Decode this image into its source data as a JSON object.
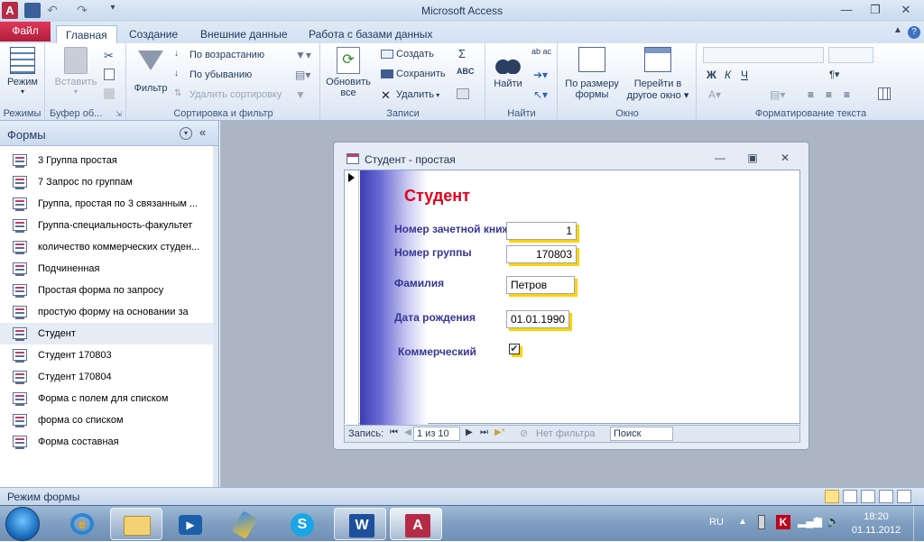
{
  "window": {
    "title": "Microsoft Access"
  },
  "tabs": [
    {
      "label": "Файл"
    },
    {
      "label": "Главная"
    },
    {
      "label": "Создание"
    },
    {
      "label": "Внешние данные"
    },
    {
      "label": "Работа с базами данных"
    }
  ],
  "ribbon": {
    "groups": {
      "views": "Режимы",
      "clipboard": "Буфер об...",
      "sort": "Сортировка и фильтр",
      "records": "Записи",
      "find": "Найти",
      "window": "Окно",
      "text": "Форматирование текста"
    },
    "views": {
      "mode": "Режим"
    },
    "clipboard": {
      "paste": "Вставить"
    },
    "sort": {
      "filter": "Фильтр",
      "ascending": "По возрастанию",
      "descending": "По убыванию",
      "remove_sort": "Удалить сортировку"
    },
    "records": {
      "refresh_line1": "Обновить",
      "refresh_line2": "все",
      "create": "Создать",
      "save": "Сохранить",
      "delete": "Удалить"
    },
    "find": {
      "find": "Найти"
    },
    "window": {
      "fit_line1": "По размеру",
      "fit_line2": "формы",
      "switch_line1": "Перейти в",
      "switch_line2": "другое окно"
    },
    "text": {
      "bold": "Ж",
      "italic": "К",
      "underline": "Ч"
    }
  },
  "nav": {
    "title": "Формы",
    "items": [
      "3 Группа простая",
      "7 Запрос по группам",
      "Группа, простая по 3 связанным ...",
      "Группа-специальность-факультет",
      "количество коммерческих студен...",
      "Подчиненная",
      "Простая форма по запросу",
      "простую форму на основании за",
      "Студент",
      "Студент 170803",
      "Студент 170804",
      "Форма с полем для списком",
      "форма со списком",
      "Форма составная"
    ],
    "selected_index": 8
  },
  "form": {
    "window_title": "Студент - простая",
    "heading": "Студент",
    "fields": {
      "record_book_label": "Номер зачетной книж",
      "record_book_value": "1",
      "group_label": "Номер группы",
      "group_value": "170803",
      "surname_label": "Фамилия",
      "surname_value": "Петров",
      "birth_label": "Дата рождения",
      "birth_value": "01.01.1990",
      "commercial_label": "Коммерческий",
      "commercial_checked": true
    },
    "record_nav": {
      "label": "Запись:",
      "position": "1 из 10",
      "no_filter": "Нет фильтра",
      "search": "Поиск"
    }
  },
  "statusbar": {
    "text": "Режим формы"
  },
  "taskbar": {
    "language": "RU",
    "time": "18:20",
    "date": "01.11.2012"
  }
}
